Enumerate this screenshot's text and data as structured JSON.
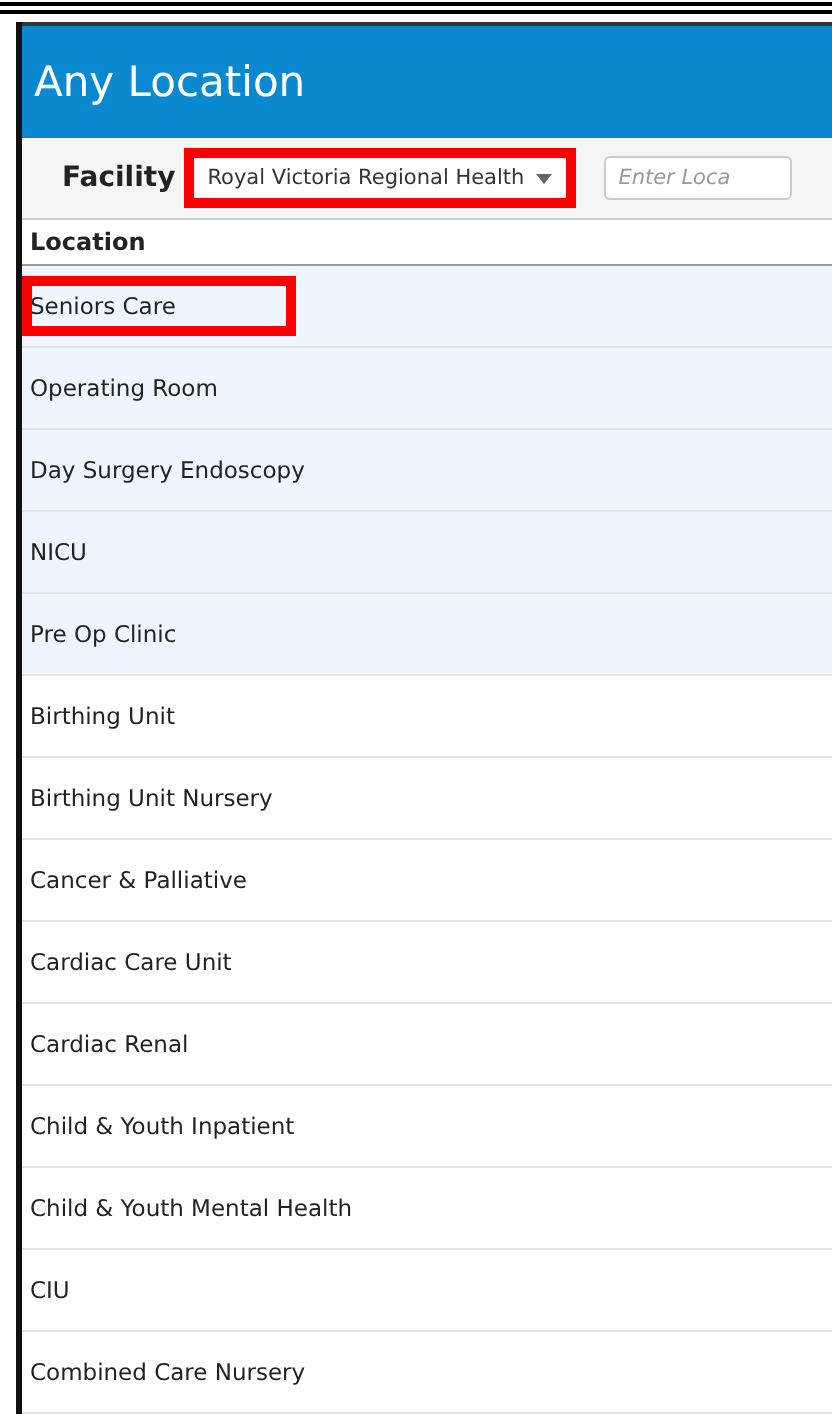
{
  "header": {
    "title": "Any Location"
  },
  "toolbar": {
    "facility_label": "Facility",
    "facility": {
      "value": "Royal Victoria Regional Health",
      "annotated": true
    },
    "search": {
      "placeholder": "Enter Loca"
    }
  },
  "table": {
    "columns": [
      "Location"
    ],
    "rows": [
      {
        "location": "Seniors Care",
        "highlighted": true,
        "annotated": true
      },
      {
        "location": "Operating Room",
        "highlighted": true,
        "annotated": false
      },
      {
        "location": "Day Surgery Endoscopy",
        "highlighted": true,
        "annotated": false
      },
      {
        "location": "NICU",
        "highlighted": true,
        "annotated": false
      },
      {
        "location": "Pre Op Clinic",
        "highlighted": true,
        "annotated": false
      },
      {
        "location": "Birthing Unit",
        "highlighted": false,
        "annotated": false
      },
      {
        "location": "Birthing Unit Nursery",
        "highlighted": false,
        "annotated": false
      },
      {
        "location": "Cancer & Palliative",
        "highlighted": false,
        "annotated": false
      },
      {
        "location": "Cardiac Care Unit",
        "highlighted": false,
        "annotated": false
      },
      {
        "location": "Cardiac Renal",
        "highlighted": false,
        "annotated": false
      },
      {
        "location": "Child & Youth Inpatient",
        "highlighted": false,
        "annotated": false
      },
      {
        "location": "Child & Youth Mental Health",
        "highlighted": false,
        "annotated": false
      },
      {
        "location": "CIU",
        "highlighted": false,
        "annotated": false
      },
      {
        "location": "Combined Care Nursery",
        "highlighted": false,
        "annotated": false
      }
    ]
  }
}
